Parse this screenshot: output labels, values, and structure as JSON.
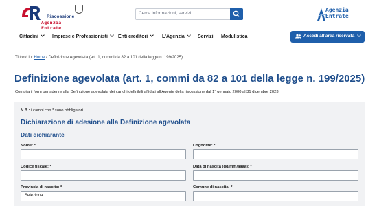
{
  "header": {
    "logo_left_line1": "Riscossione",
    "logo_left_line2": "Agenzia Entrate",
    "search_placeholder": "Cerca informazioni, servizi",
    "logo_right_line1": "Agenzia",
    "logo_right_line2": "Entrate"
  },
  "nav": {
    "items": [
      {
        "label": "Cittadini"
      },
      {
        "label": "Imprese e Professionisti"
      },
      {
        "label": "Enti creditori"
      },
      {
        "label": "L'Agenzia"
      },
      {
        "label": "Servizi"
      },
      {
        "label": "Modulistica"
      }
    ],
    "login_label": "Accedi all'area riservata"
  },
  "breadcrumb": {
    "prefix": "Ti trovi in:",
    "home": "Home",
    "separator": "/",
    "current": "Definizione Agevolata (art. 1, commi da 82 a 101 della legge n. 199/2025)"
  },
  "page": {
    "title": "Definizione agevolata (art. 1, commi da 82 a 101 della legge n. 199/2025)",
    "subtitle": "Compila il form per aderire alla Definizione agevolata dei carichi definibili affidati all'Agente della riscossione dal 1° gennaio 2000 al 31 dicembre 2023."
  },
  "form": {
    "note_bold": "N.B.:",
    "note_text": " i campi con * sono obbligatori",
    "section_title": "Dichiarazione di adesione alla Definizione agevolata",
    "subsection_title": "Dati dichiarante",
    "fields": {
      "nome": {
        "label": "Nome: *",
        "value": ""
      },
      "cognome": {
        "label": "Cognome: *",
        "value": ""
      },
      "codice_fiscale": {
        "label": "Codice fiscale: *",
        "value": ""
      },
      "data_nascita": {
        "label": "Data di nascita (gg/mm/aaaa): *",
        "value": ""
      },
      "provincia_nascita": {
        "label": "Provincia di nascita: *",
        "value": "Seleziona"
      },
      "comune_nascita": {
        "label": "Comune di nascita: *",
        "value": ""
      }
    }
  },
  "colors": {
    "primary": "#1f5fab",
    "title": "#1f4e8c",
    "brand_red": "#c8102e",
    "panel_bg": "#f1f2f4"
  },
  "icons": {
    "search": "search-icon",
    "login": "users-icon",
    "chevron": "chevron-down-icon"
  }
}
